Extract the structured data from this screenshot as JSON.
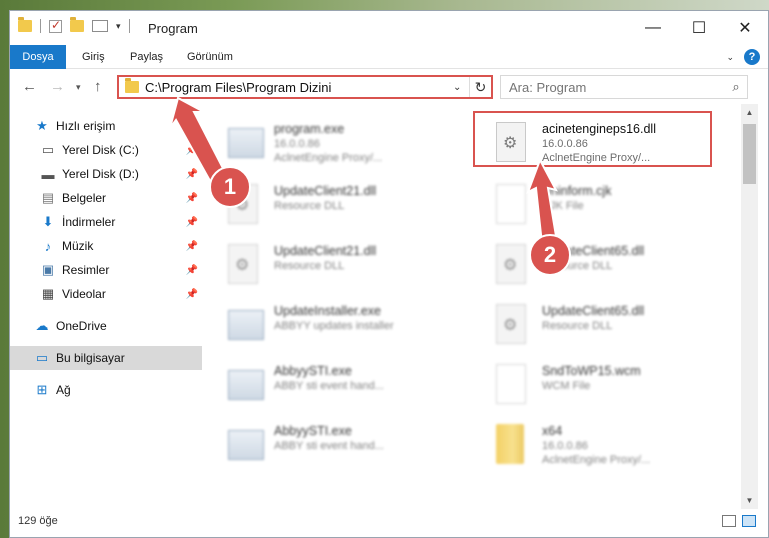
{
  "window": {
    "title": "Program"
  },
  "ribbon": {
    "tabs": [
      "Dosya",
      "Giriş",
      "Paylaş",
      "Görünüm"
    ]
  },
  "address": {
    "path": "C:\\Program Files\\Program Dizini"
  },
  "search": {
    "placeholder": "Ara: Program"
  },
  "sidebar": {
    "quick_access": "Hızlı erişim",
    "items": [
      {
        "label": "Yerel Disk (C:)",
        "icon": "drive-icon"
      },
      {
        "label": "Yerel Disk (D:)",
        "icon": "drive-icon"
      },
      {
        "label": "Belgeler",
        "icon": "documents-icon"
      },
      {
        "label": "İndirmeler",
        "icon": "downloads-icon"
      },
      {
        "label": "Müzik",
        "icon": "music-icon"
      },
      {
        "label": "Resimler",
        "icon": "pictures-icon"
      },
      {
        "label": "Videolar",
        "icon": "videos-icon"
      }
    ],
    "onedrive": "OneDrive",
    "this_pc": "Bu bilgisayar",
    "network": "Ağ"
  },
  "files": [
    {
      "name": "program.exe",
      "line2": "16.0.0.86",
      "line3": "AclnetEngine Proxy/...",
      "icon": "exe-icon"
    },
    {
      "name": "acinetengineps16.dll",
      "line2": "16.0.0.86",
      "line3": "AclnetEngine Proxy/...",
      "icon": "dll-icon"
    },
    {
      "name": "UpdateClient21.dll",
      "line2": "Resource DLL",
      "line3": "",
      "icon": "dll-icon"
    },
    {
      "name": "Uninform.cjk",
      "line2": "CJK File",
      "line3": "",
      "icon": "document-icon"
    },
    {
      "name": "UpdateClient21.dll",
      "line2": "Resource DLL",
      "line3": "",
      "icon": "dll-icon"
    },
    {
      "name": "UpdateClient65.dll",
      "line2": "Resource DLL",
      "line3": "",
      "icon": "dll-icon"
    },
    {
      "name": "UpdateInstaller.exe",
      "line2": "ABBYY updates installer",
      "line3": "",
      "icon": "exe-icon"
    },
    {
      "name": "UpdateClient65.dll",
      "line2": "Resource DLL",
      "line3": "",
      "icon": "dll-icon"
    },
    {
      "name": "AbbyySTI.exe",
      "line2": "ABBY sti event hand...",
      "line3": "",
      "icon": "exe-icon"
    },
    {
      "name": "SndToWP15.wcm",
      "line2": "WCM File",
      "line3": "",
      "icon": "document-icon"
    },
    {
      "name": "AbbyySTI.exe",
      "line2": "ABBY sti event hand...",
      "line3": "",
      "icon": "exe-icon"
    },
    {
      "name": "x64",
      "line2": "16.0.0.86",
      "line3": "AclnetEngine Proxy/...",
      "icon": "folder-icon"
    }
  ],
  "status": {
    "item_count": "129 öğe"
  },
  "callouts": [
    "1",
    "2"
  ],
  "colors": {
    "accent": "#1979ca",
    "highlight": "#d9534f"
  }
}
